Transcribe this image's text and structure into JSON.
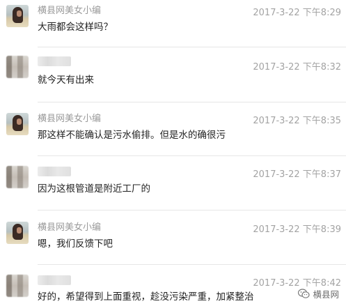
{
  "messages": [
    {
      "sender_name": "横县网美女小编",
      "time": "2017-3-22 下午8:29",
      "text": "大雨都会这样吗？",
      "avatar": "editor-avatar"
    },
    {
      "sender_name": "",
      "time": "2017-3-22 下午8:32",
      "text": "就今天有出来",
      "avatar": "blurred-avatar"
    },
    {
      "sender_name": "横县网美女小编",
      "time": "2017-3-22 下午8:35",
      "text": "那这样不能确认是污水偷排。但是水的确很污",
      "avatar": "editor-avatar"
    },
    {
      "sender_name": "",
      "time": "2017-3-22 下午8:37",
      "text": "因为这根管道是附近工厂的",
      "avatar": "blurred-avatar"
    },
    {
      "sender_name": "横县网美女小编",
      "time": "2017-3-22 下午8:39",
      "text": "嗯，我们反馈下吧",
      "avatar": "editor-avatar"
    },
    {
      "sender_name": "",
      "time": "2017-3-22 下午8:42",
      "text": "好的，希望得到上面重视，趁没污染严重，加紧整治",
      "avatar": "blurred-avatar"
    }
  ],
  "watermark": {
    "text": "横县网",
    "icon": "wechat-icon"
  }
}
